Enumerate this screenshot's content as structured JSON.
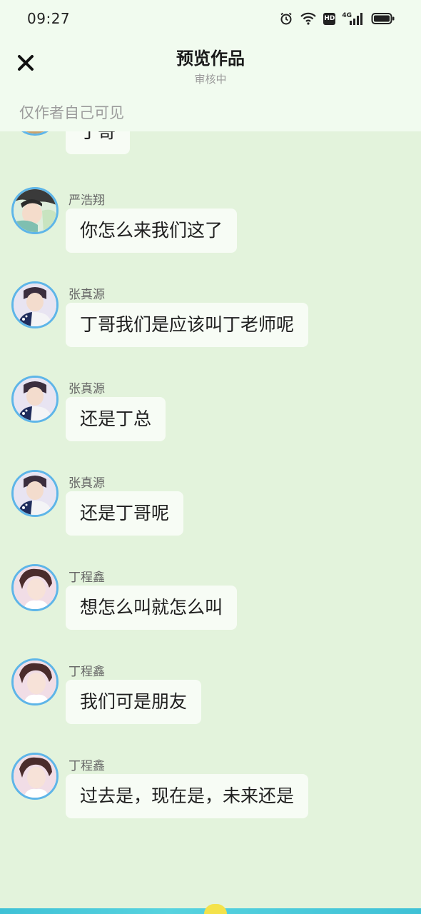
{
  "status_bar": {
    "time": "09:27",
    "icons": [
      "alarm-icon",
      "wifi-icon",
      "hd-icon",
      "signal-4g-icon",
      "battery-icon"
    ],
    "hd_label": "HD",
    "network_label": "4G"
  },
  "header": {
    "title": "预览作品",
    "subtitle": "审核中",
    "visibility_note": "仅作者自己可见",
    "close_icon": "close-icon"
  },
  "colors": {
    "chat_background": "#e3f3dc",
    "header_background": "#f1fbef",
    "bubble_background": "#f7fcf5",
    "avatar_border": "#5eb5e8"
  },
  "messages": [
    {
      "sender": "",
      "text": "丁哥",
      "avatar": "avatar-partial"
    },
    {
      "sender": "严浩翔",
      "text": "你怎么来我们这了",
      "avatar": "avatar-yan"
    },
    {
      "sender": "张真源",
      "text": "丁哥我们是应该叫丁老师呢",
      "avatar": "avatar-zhang"
    },
    {
      "sender": "张真源",
      "text": "还是丁总",
      "avatar": "avatar-zhang"
    },
    {
      "sender": "张真源",
      "text": "还是丁哥呢",
      "avatar": "avatar-zhang"
    },
    {
      "sender": "丁程鑫",
      "text": "想怎么叫就怎么叫",
      "avatar": "avatar-ding"
    },
    {
      "sender": "丁程鑫",
      "text": "我们可是朋友",
      "avatar": "avatar-ding"
    },
    {
      "sender": "丁程鑫",
      "text": "过去是，现在是，未来还是",
      "avatar": "avatar-ding"
    }
  ]
}
